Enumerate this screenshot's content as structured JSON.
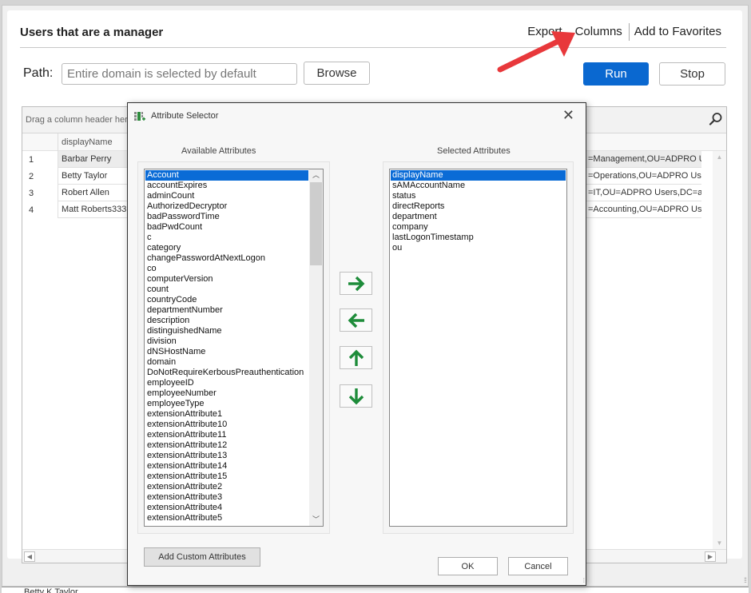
{
  "report": {
    "title": "Users that are a manager",
    "links": {
      "export": "Export",
      "columns": "Columns",
      "favorites": "Add to Favorites"
    },
    "path_label": "Path:",
    "path_value": "",
    "path_placeholder": "Entire domain is selected by default",
    "browse_label": "Browse",
    "run_label": "Run",
    "stop_label": "Stop"
  },
  "grid": {
    "group_hint": "Drag a column header here",
    "columns": [
      "displayName"
    ],
    "rows": [
      {
        "num": "1",
        "displayName": "Barbar Perry",
        "dn": "=Management,OU=ADPRO Users"
      },
      {
        "num": "2",
        "displayName": "Betty Taylor",
        "dn": "=Operations,OU=ADPRO Users,"
      },
      {
        "num": "3",
        "displayName": "Robert Allen",
        "dn": "=IT,OU=ADPRO Users,DC=ad,D"
      },
      {
        "num": "4",
        "displayName": "Matt Roberts333",
        "dn": "=Accounting,OU=ADPRO Users,"
      }
    ]
  },
  "dialog": {
    "title": "Attribute Selector",
    "available_label": "Available Attributes",
    "selected_label": "Selected Attributes",
    "available": [
      "Account",
      "accountExpires",
      "adminCount",
      "AuthorizedDecryptor",
      "badPasswordTime",
      "badPwdCount",
      "c",
      "category",
      "changePasswordAtNextLogon",
      "co",
      "computerVersion",
      "count",
      "countryCode",
      "departmentNumber",
      "description",
      "distinguishedName",
      "division",
      "dNSHostName",
      "domain",
      "DoNotRequireKerbousPreauthentication",
      "employeeID",
      "employeeNumber",
      "employeeType",
      "extensionAttribute1",
      "extensionAttribute10",
      "extensionAttribute11",
      "extensionAttribute12",
      "extensionAttribute13",
      "extensionAttribute14",
      "extensionAttribute15",
      "extensionAttribute2",
      "extensionAttribute3",
      "extensionAttribute4",
      "extensionAttribute5"
    ],
    "available_selected": "Account",
    "selected": [
      "displayName",
      "sAMAccountName",
      "status",
      "directReports",
      "department",
      "company",
      "lastLogonTimestamp",
      "ou"
    ],
    "selected_selected": "displayName",
    "add_custom_label": "Add Custom Attributes",
    "ok_label": "OK",
    "cancel_label": "Cancel",
    "accent_color": "#1e8c3a"
  },
  "statusbar": {
    "text": "Betty K Taylor"
  }
}
